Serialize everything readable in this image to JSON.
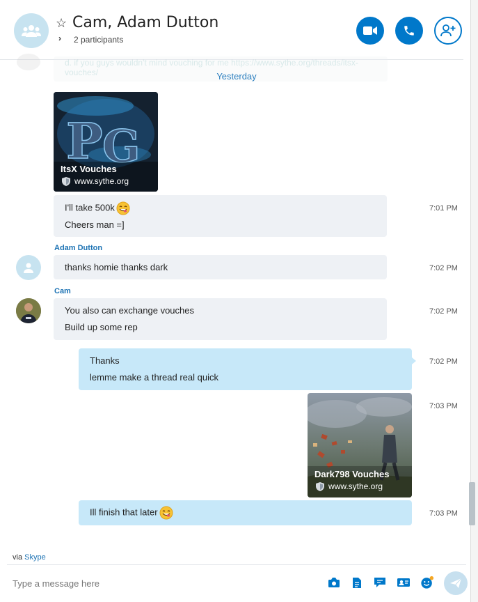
{
  "header": {
    "title": "Cam, Adam Dutton",
    "participants": "2 participants"
  },
  "faded_preview": "d. if you guys wouldn't mind vouching for me https://www.sythe.org/threads/itsx-vouches/",
  "date_separator": "Yesterday",
  "cards": [
    {
      "title": "ItsX Vouches",
      "site": "www.sythe.org"
    },
    {
      "title": "Dark798 Vouches",
      "site": "www.sythe.org"
    }
  ],
  "messages": [
    {
      "lines": [
        "I'll take 500k",
        "Cheers man =]"
      ],
      "time": "7:01 PM"
    },
    {
      "sender": "Adam Dutton",
      "lines": [
        "thanks homie   thanks dark"
      ],
      "time": "7:02 PM"
    },
    {
      "sender": "Cam",
      "lines": [
        "You also can exchange vouches",
        "Build up some rep"
      ],
      "time": "7:02 PM"
    },
    {
      "lines": [
        "Thanks",
        "lemme make a thread real quick"
      ],
      "time": "7:02 PM"
    },
    {
      "time": "7:03 PM"
    },
    {
      "lines": [
        "Ill finish that later"
      ],
      "time": "7:03 PM"
    }
  ],
  "footer": {
    "via_prefix": "via",
    "via_service": "Skype",
    "placeholder": "Type a message here"
  },
  "colors": {
    "accent": "#0078ca",
    "outgoing_bubble": "#c7e8f9",
    "incoming_bubble": "#eef1f5",
    "link": "#1d73b4"
  },
  "icons": [
    "group-avatar-icon",
    "star-icon",
    "chevron-right-icon",
    "video-call-icon",
    "phone-icon",
    "add-participant-icon",
    "shield-icon",
    "emoji-yum-icon",
    "media-icon",
    "file-icon",
    "chat-icon",
    "contact-card-icon",
    "emoticon-icon",
    "send-icon"
  ]
}
